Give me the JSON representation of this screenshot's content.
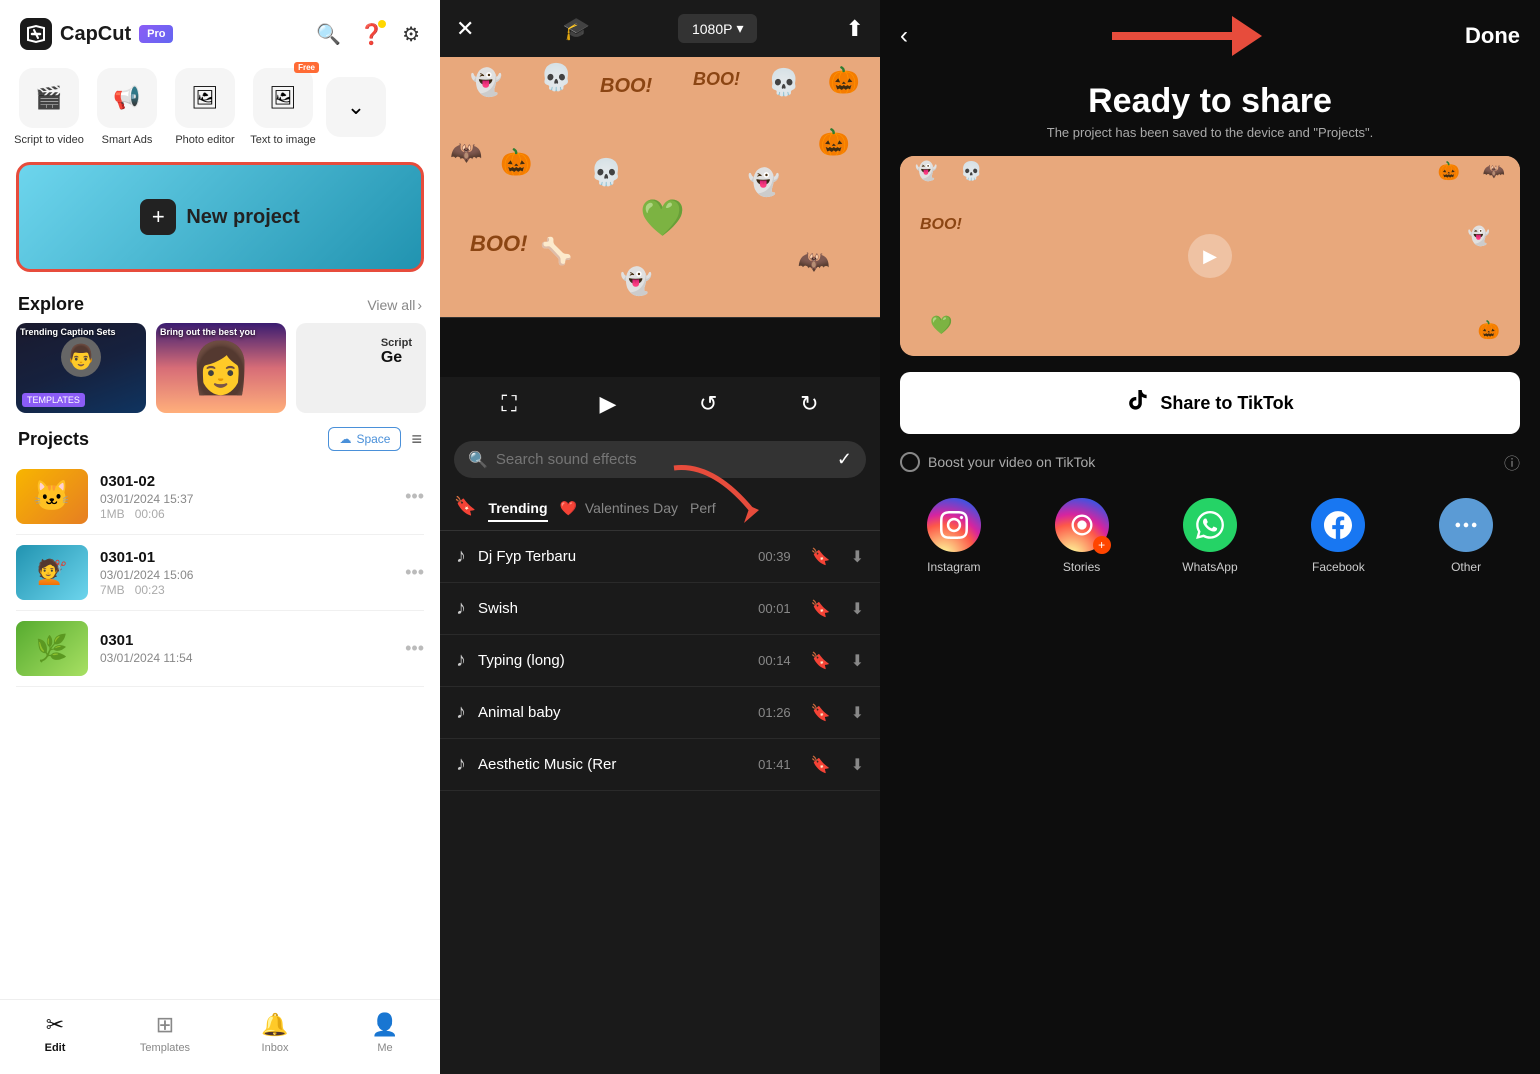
{
  "app": {
    "name": "CapCut",
    "pro_label": "Pro"
  },
  "quick_actions": [
    {
      "id": "script-to-video",
      "label": "Script to video",
      "icon": "🎬"
    },
    {
      "id": "smart-ads",
      "label": "Smart Ads",
      "icon": "📢"
    },
    {
      "id": "photo-editor",
      "label": "Photo editor",
      "icon": "🖼"
    },
    {
      "id": "text-to-image",
      "label": "Text to image",
      "icon": "🖼",
      "badge": "Free"
    }
  ],
  "new_project": {
    "label": "New project"
  },
  "explore": {
    "title": "Explore",
    "view_all": "View all",
    "cards": [
      {
        "id": "trending-captions",
        "label": "Trending Caption Sets"
      },
      {
        "id": "bring-out-best",
        "label": "Bring out the best you"
      },
      {
        "id": "script",
        "label": "Script"
      }
    ]
  },
  "projects": {
    "title": "Projects",
    "space_label": "Space",
    "items": [
      {
        "id": "0301-02",
        "name": "0301-02",
        "date": "03/01/2024 15:37",
        "size": "1MB",
        "duration": "00:06"
      },
      {
        "id": "0301-01",
        "name": "0301-01",
        "date": "03/01/2024 15:06",
        "size": "7MB",
        "duration": "00:23"
      },
      {
        "id": "0301",
        "name": "0301",
        "date": "03/01/2024 11:54",
        "size": "",
        "duration": ""
      }
    ]
  },
  "bottom_nav": [
    {
      "id": "edit",
      "label": "Edit",
      "icon": "✂",
      "active": true
    },
    {
      "id": "templates",
      "label": "Templates",
      "icon": "⊞",
      "active": false
    },
    {
      "id": "inbox",
      "label": "Inbox",
      "icon": "🔔",
      "active": false
    },
    {
      "id": "me",
      "label": "Me",
      "icon": "👤",
      "active": false
    }
  ],
  "editor": {
    "resolution": "1080P",
    "search_placeholder": "Search sound effects",
    "tabs": [
      {
        "id": "trending",
        "label": "Trending",
        "active": true
      },
      {
        "id": "valentines",
        "label": "Valentines Day",
        "active": false
      },
      {
        "id": "perf",
        "label": "Perf",
        "active": false
      }
    ],
    "sounds": [
      {
        "name": "Dj Fyp Terbaru",
        "duration": "00:39"
      },
      {
        "name": "Swish",
        "duration": "00:01"
      },
      {
        "name": "Typing (long)",
        "duration": "00:14"
      },
      {
        "name": "Animal baby",
        "duration": "01:26"
      },
      {
        "name": "Aesthetic Music (Rer",
        "duration": "01:41"
      }
    ]
  },
  "share": {
    "title": "Ready to share",
    "subtitle": "The project has been saved to the device and \"Projects\".",
    "done_label": "Done",
    "tiktok_label": "Share to TikTok",
    "boost_label": "Boost your video on TikTok",
    "platforms": [
      {
        "id": "instagram",
        "label": "Instagram"
      },
      {
        "id": "stories",
        "label": "Stories"
      },
      {
        "id": "whatsapp",
        "label": "WhatsApp"
      },
      {
        "id": "facebook",
        "label": "Facebook"
      },
      {
        "id": "other",
        "label": "Other"
      }
    ]
  }
}
